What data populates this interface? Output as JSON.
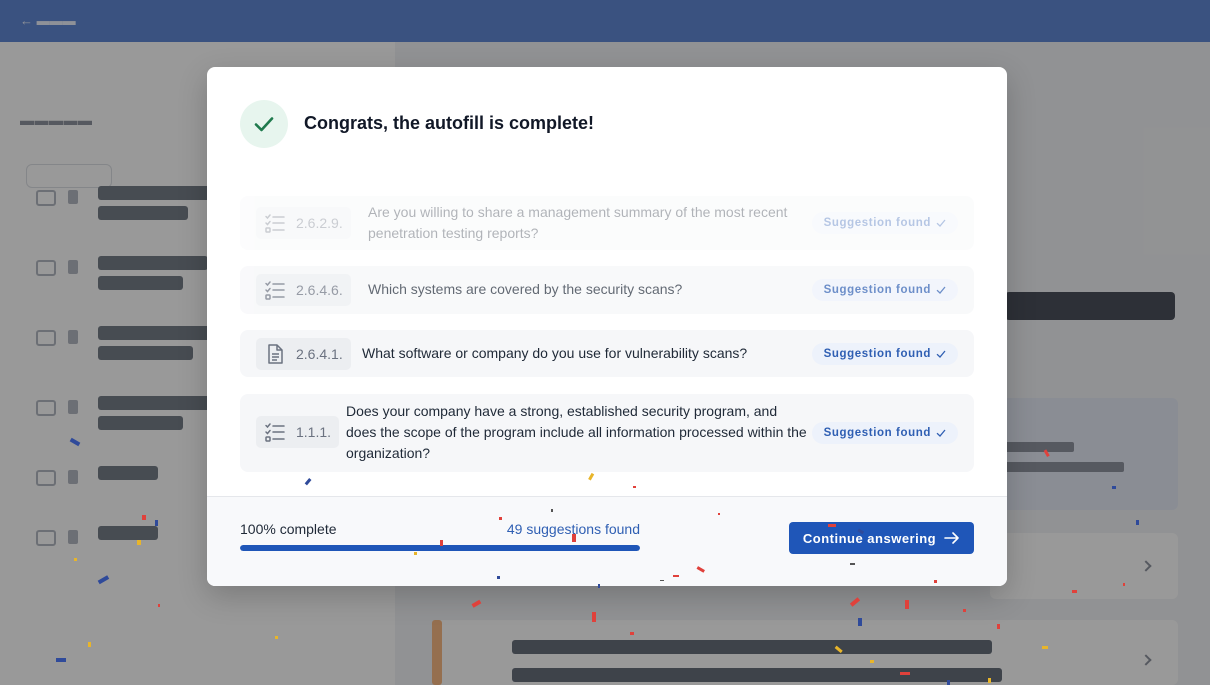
{
  "dialog": {
    "title": "Congrats, the autofill is complete!",
    "questions": [
      {
        "number": "2.6.2.9.",
        "text": "Are you willing to share a management summary of the most recent penetration testing reports?",
        "status": "Suggestion found",
        "icon": "checklist-icon"
      },
      {
        "number": "2.6.4.6.",
        "text": "Which systems are covered by the security scans?",
        "status": "Suggestion found",
        "icon": "checklist-icon"
      },
      {
        "number": "2.6.4.1.",
        "text": "What software or company do you use for vulnerability scans?",
        "status": "Suggestion found",
        "icon": "document-icon"
      },
      {
        "number": "1.1.1.",
        "text": "Does your company have a strong, established security program, and does the scope of the program include all information processed within the organization?",
        "status": "Suggestion found",
        "icon": "checklist-icon"
      }
    ],
    "footer": {
      "progress_label": "100% complete",
      "progress_value": 100,
      "suggestions_label": "49 suggestions found",
      "continue_label": "Continue answering"
    }
  },
  "colors": {
    "accent": "#1f56b8",
    "success": "#1f7a4d",
    "topbar": "#2d63c8"
  }
}
